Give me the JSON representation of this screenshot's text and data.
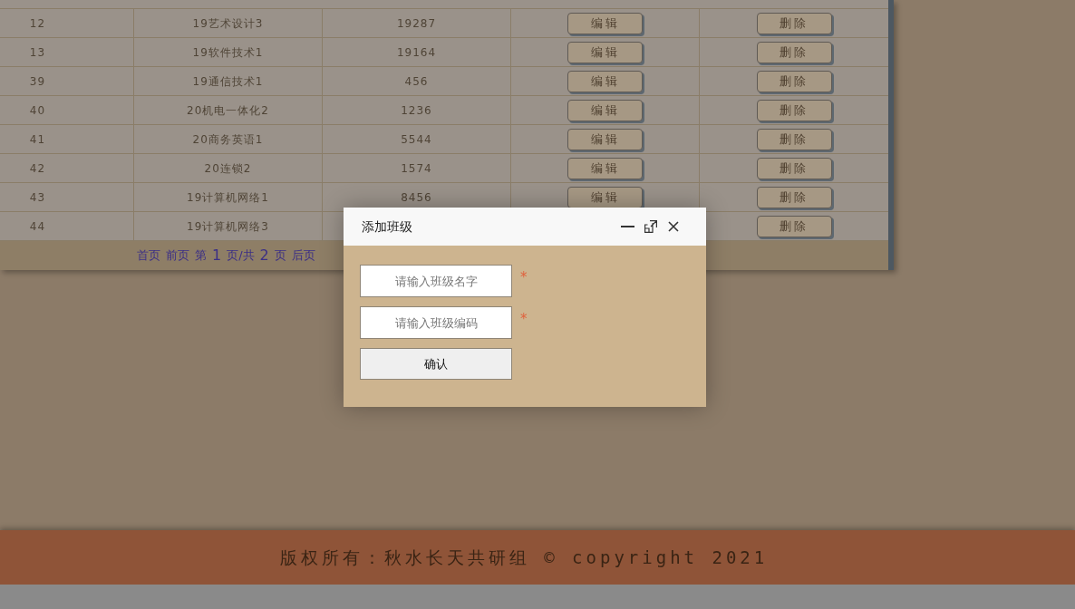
{
  "table": {
    "rows": [
      {
        "id": "12",
        "name": "19艺术设计3",
        "code": "19287",
        "edit": "编辑",
        "delete": "删除"
      },
      {
        "id": "13",
        "name": "19软件技术1",
        "code": "19164",
        "edit": "编辑",
        "delete": "删除"
      },
      {
        "id": "39",
        "name": "19通信技术1",
        "code": "456",
        "edit": "编辑",
        "delete": "删除"
      },
      {
        "id": "40",
        "name": "20机电一体化2",
        "code": "1236",
        "edit": "编辑",
        "delete": "删除"
      },
      {
        "id": "41",
        "name": "20商务英语1",
        "code": "5544",
        "edit": "编辑",
        "delete": "删除"
      },
      {
        "id": "42",
        "name": "20连锁2",
        "code": "1574",
        "edit": "编辑",
        "delete": "删除"
      },
      {
        "id": "43",
        "name": "19计算机网络1",
        "code": "8456",
        "edit": "编辑",
        "delete": "删除"
      },
      {
        "id": "44",
        "name": "19计算机网络3",
        "delete": "删除"
      }
    ]
  },
  "pagination": [
    {
      "kind": "link",
      "text": "首页"
    },
    {
      "kind": "link",
      "text": "前页"
    },
    {
      "kind": "text",
      "text": "第"
    },
    {
      "kind": "number",
      "text": "1"
    },
    {
      "kind": "text",
      "text": "页/共"
    },
    {
      "kind": "number",
      "text": "2"
    },
    {
      "kind": "text",
      "text": "页"
    },
    {
      "kind": "link",
      "text": "后页"
    }
  ],
  "dialog": {
    "title": "添加班级",
    "fields": [
      {
        "placeholder": "请输入班级名字",
        "required": true
      },
      {
        "placeholder": "请输入班级编码",
        "required": true
      }
    ],
    "required_mark": "*",
    "submit": "确认"
  },
  "footer": "版权所有：秋水长天共研组 © copyright 2021"
}
